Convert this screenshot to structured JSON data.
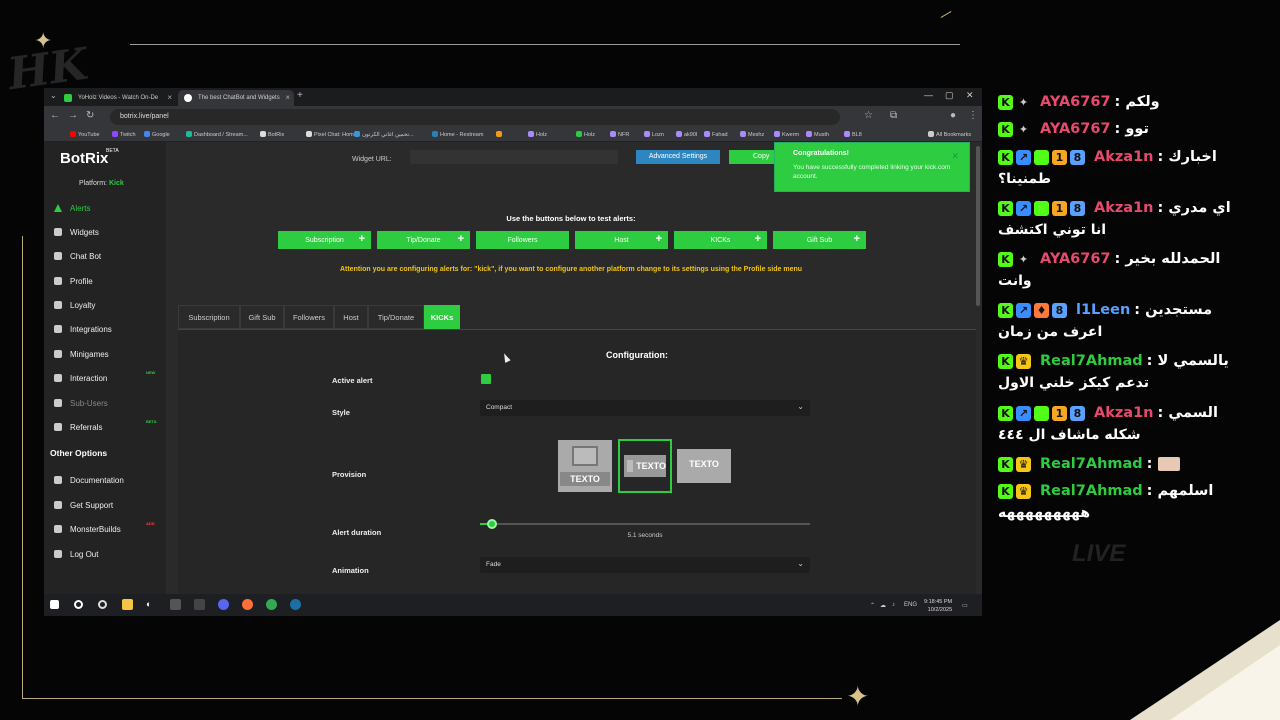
{
  "browser": {
    "tabs": [
      {
        "title": "YoHolz Videos - Watch On-De",
        "color": "#2ecc40",
        "active": false
      },
      {
        "title": "The best ChatBot and Widgets",
        "color": "#ffffff",
        "active": true
      }
    ],
    "url": "botrix.live/panel",
    "bookmarks": [
      {
        "label": "YouTube",
        "color": "#ff0000"
      },
      {
        "label": "Twitch",
        "color": "#9146ff"
      },
      {
        "label": "Google",
        "color": "#4285f4"
      },
      {
        "label": "Dashboard / Stream...",
        "color": "#1abc9c"
      },
      {
        "label": "BotRix",
        "color": "#dddddd"
      },
      {
        "label": "Pixel Chat: Home",
        "color": "#dddddd"
      },
      {
        "label": "تخمين اغاني الكرتون...",
        "color": "#3498db"
      },
      {
        "label": "Home - Restream",
        "color": "#2980b9"
      },
      {
        "label": "",
        "color": "#f39c12"
      },
      {
        "label": "Holz",
        "color": "#aa88ff"
      },
      {
        "label": "Holz",
        "color": "#2ecc40"
      },
      {
        "label": "NFR",
        "color": "#aa88ff"
      },
      {
        "label": "Lozn",
        "color": "#aa88ff"
      },
      {
        "label": "ak90I",
        "color": "#aa88ff"
      },
      {
        "label": "Fahad",
        "color": "#aa88ff"
      },
      {
        "label": "Meshz",
        "color": "#aa88ff"
      },
      {
        "label": "Kwerm",
        "color": "#aa88ff"
      },
      {
        "label": "Musth",
        "color": "#aa88ff"
      },
      {
        "label": "BL8",
        "color": "#aa88ff"
      }
    ],
    "all_bookmarks": "All Bookmarks"
  },
  "sidebar": {
    "logo": "BotRix",
    "logo_badge": "BETA",
    "platform_label": "Platform:",
    "platform_value": "Kick",
    "items": [
      {
        "label": "Alerts",
        "state": "active"
      },
      {
        "label": "Widgets",
        "state": ""
      },
      {
        "label": "Chat Bot",
        "state": ""
      },
      {
        "label": "Profile",
        "state": ""
      },
      {
        "label": "Loyalty",
        "state": ""
      },
      {
        "label": "Integrations",
        "state": ""
      },
      {
        "label": "Minigames",
        "state": ""
      },
      {
        "label": "Interaction",
        "state": "",
        "badge": "NEW"
      },
      {
        "label": "Sub-Users",
        "state": "muted"
      },
      {
        "label": "Referrals",
        "state": "",
        "badge": "BETA"
      }
    ],
    "other_title": "Other Options",
    "other_items": [
      {
        "label": "Documentation"
      },
      {
        "label": "Get Support"
      },
      {
        "label": "MonsterBuilds",
        "badge": "ADD"
      },
      {
        "label": "Log Out"
      }
    ]
  },
  "main": {
    "widget_url_label": "Widget URL:",
    "advanced_label": "Advanced Settings",
    "copy_label": "Copy",
    "toast": {
      "title": "Congratulations!",
      "message": "You have successfully completed linking your kick.com account."
    },
    "test_title": "Use the buttons below to test alerts:",
    "test_buttons": [
      {
        "label": "Subscription",
        "plus": true
      },
      {
        "label": "Tip/Donate",
        "plus": true
      },
      {
        "label": "Followers",
        "plus": false
      },
      {
        "label": "Host",
        "plus": true
      },
      {
        "label": "KICKs",
        "plus": true
      },
      {
        "label": "Gift Sub",
        "plus": true
      }
    ],
    "attention": "Attention you are configuring alerts for: \"kick\", if you want to configure another platform change to its settings using the Profile side menu",
    "alert_tabs": [
      {
        "label": "Subscription",
        "active": false
      },
      {
        "label": "Gift Sub",
        "active": false
      },
      {
        "label": "Followers",
        "active": false
      },
      {
        "label": "Host",
        "active": false
      },
      {
        "label": "Tip/Donate",
        "active": false
      },
      {
        "label": "KICKs",
        "active": true
      }
    ],
    "config": {
      "title": "Configuration:",
      "active_alert_label": "Active alert",
      "active_alert": true,
      "style_label": "Style",
      "style_value": "Compact",
      "provision_label": "Provision",
      "provision_text": "TEXTO",
      "provision_selected": 1,
      "duration_label": "Alert duration",
      "duration_fraction": 0.03,
      "duration_value": "5.1 seconds",
      "animation_label": "Animation",
      "animation_value": "Fade"
    }
  },
  "taskbar": {
    "lang": "ENG",
    "time": "9:18:45 PM",
    "date": "10/2/2025"
  },
  "chat": {
    "messages": [
      {
        "user": "AYA6767",
        "user_color": "#e84a6f",
        "text": ": ولكم",
        "badges": [
          "K",
          "✦"
        ]
      },
      {
        "user": "AYA6767",
        "user_color": "#e84a6f",
        "text": ": توو",
        "badges": [
          "K",
          "✦"
        ]
      },
      {
        "user": "Akza1n",
        "user_color": "#e84a6f",
        "text": ": اخبارك",
        "text2": "طمنينا؟",
        "badges": [
          "K",
          "↗",
          "■",
          "1",
          "8"
        ]
      },
      {
        "user": "Akza1n",
        "user_color": "#e84a6f",
        "text": ": اي مدري",
        "text2": "انا توني اكتشف",
        "badges": [
          "K",
          "↗",
          "■",
          "1",
          "8"
        ]
      },
      {
        "user": "AYA6767",
        "user_color": "#e84a6f",
        "text": ": الحمدلله بخير",
        "text2": "وانت",
        "badges": [
          "K",
          "✦"
        ]
      },
      {
        "user": "l1Leen",
        "user_color": "#5aa0ff",
        "text": ": مستجدين",
        "text2": "اعرف من زمان",
        "badges": [
          "K",
          "↗",
          "♦",
          "8"
        ]
      },
      {
        "user": "Real7Ahmad",
        "user_color": "#2ecc40",
        "text": ": يالسمي لا",
        "text2": "تدعم كيكز خلني الاول",
        "badges": [
          "K",
          "♛"
        ]
      },
      {
        "user": "Akza1n",
        "user_color": "#e84a6f",
        "text": ": السمي",
        "text2": "شكله ماشاف ال ٤٤٤",
        "badges": [
          "K",
          "↗",
          "■",
          "1",
          "8"
        ]
      },
      {
        "user": "Real7Ahmad",
        "user_color": "#2ecc40",
        "text": ":",
        "badges": [
          "K",
          "♛"
        ]
      },
      {
        "user": "Real7Ahmad",
        "user_color": "#2ecc40",
        "text": ": اسلمهم",
        "text2": "هههههههههه",
        "badges": [
          "K",
          "♛"
        ]
      }
    ]
  },
  "overlay": {
    "watermark": "LIVE",
    "logo_text": "HK"
  }
}
